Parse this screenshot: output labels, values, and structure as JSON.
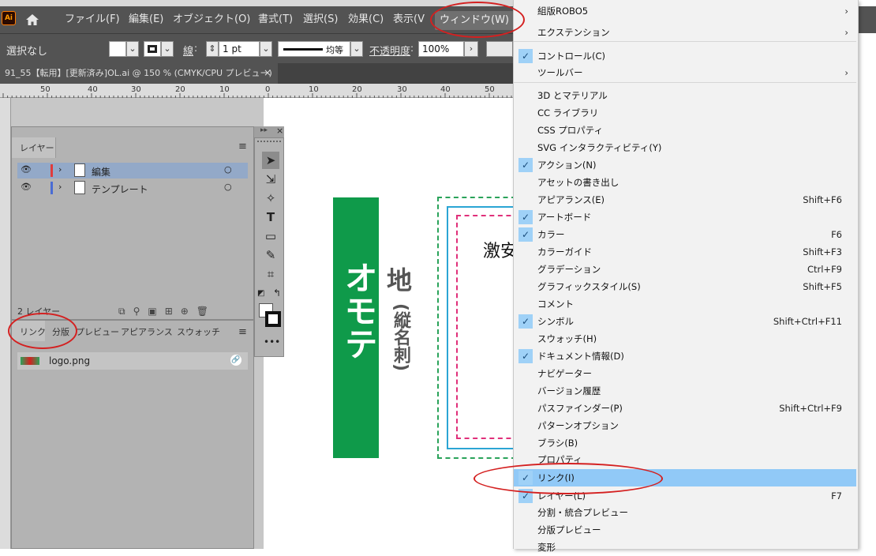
{
  "menubar": {
    "app_icon": "Ai",
    "items": [
      "ファイル(F)",
      "編集(E)",
      "オブジェクト(O)",
      "書式(T)",
      "選択(S)",
      "効果(C)",
      "表示(V",
      "ウィンドウ(W)"
    ]
  },
  "control_bar": {
    "selection": "選択なし",
    "stroke_label": "線",
    "stroke_weight": "1 pt",
    "stroke_style": "均等",
    "opacity_label": "不透明度",
    "opacity_value": "100%"
  },
  "document_tab": {
    "title": "91_55【転用】[更新済み]OL.ai @ 150 % (CMYK/CPU プレビュー)",
    "close": "×"
  },
  "ruler": {
    "ticks": [
      "50",
      "40",
      "30",
      "20",
      "10",
      "0",
      "10",
      "20",
      "30",
      "40",
      "50"
    ]
  },
  "layers_panel": {
    "tab": "レイヤー",
    "layers": [
      {
        "name": "編集",
        "color": "#e03c3c"
      },
      {
        "name": "テンプレート",
        "color": "#4a6cd4"
      }
    ],
    "footer": "2 レイヤー"
  },
  "links_panel": {
    "tabs": [
      "リンク",
      "分版",
      "プレビュー",
      "アピアランス",
      "スウォッチ"
    ],
    "files": [
      {
        "name": "logo.png"
      }
    ]
  },
  "artwork": {
    "vertical_title": "オモテ",
    "side_text_1": "地",
    "side_text_2": "(縦名刺)",
    "card_text": "激安"
  },
  "window_menu": {
    "items": [
      {
        "label": "組版ROBO5",
        "submenu": true,
        "checked": false,
        "shortcut": ""
      },
      {
        "label": "エクステンション",
        "submenu": true,
        "checked": false,
        "shortcut": ""
      },
      {
        "label": "コントロール(C)",
        "submenu": false,
        "checked": true,
        "shortcut": ""
      },
      {
        "label": "ツールバー",
        "submenu": true,
        "checked": false,
        "shortcut": ""
      },
      {
        "label": "3D とマテリアル",
        "submenu": false,
        "checked": false,
        "shortcut": ""
      },
      {
        "label": "CC ライブラリ",
        "submenu": false,
        "checked": false,
        "shortcut": ""
      },
      {
        "label": "CSS プロパティ",
        "submenu": false,
        "checked": false,
        "shortcut": ""
      },
      {
        "label": "SVG インタラクティビティ(Y)",
        "submenu": false,
        "checked": false,
        "shortcut": ""
      },
      {
        "label": "アクション(N)",
        "submenu": false,
        "checked": true,
        "shortcut": ""
      },
      {
        "label": "アセットの書き出し",
        "submenu": false,
        "checked": false,
        "shortcut": ""
      },
      {
        "label": "アピアランス(E)",
        "submenu": false,
        "checked": false,
        "shortcut": "Shift+F6"
      },
      {
        "label": "アートボード",
        "submenu": false,
        "checked": true,
        "shortcut": ""
      },
      {
        "label": "カラー",
        "submenu": false,
        "checked": true,
        "shortcut": "F6"
      },
      {
        "label": "カラーガイド",
        "submenu": false,
        "checked": false,
        "shortcut": "Shift+F3"
      },
      {
        "label": "グラデーション",
        "submenu": false,
        "checked": false,
        "shortcut": "Ctrl+F9"
      },
      {
        "label": "グラフィックスタイル(S)",
        "submenu": false,
        "checked": false,
        "shortcut": "Shift+F5"
      },
      {
        "label": "コメント",
        "submenu": false,
        "checked": false,
        "shortcut": ""
      },
      {
        "label": "シンボル",
        "submenu": false,
        "checked": true,
        "shortcut": "Shift+Ctrl+F11"
      },
      {
        "label": "スウォッチ(H)",
        "submenu": false,
        "checked": false,
        "shortcut": ""
      },
      {
        "label": "ドキュメント情報(D)",
        "submenu": false,
        "checked": true,
        "shortcut": ""
      },
      {
        "label": "ナビゲーター",
        "submenu": false,
        "checked": false,
        "shortcut": ""
      },
      {
        "label": "バージョン履歴",
        "submenu": false,
        "checked": false,
        "shortcut": ""
      },
      {
        "label": "パスファインダー(P)",
        "submenu": false,
        "checked": false,
        "shortcut": "Shift+Ctrl+F9"
      },
      {
        "label": "パターンオプション",
        "submenu": false,
        "checked": false,
        "shortcut": ""
      },
      {
        "label": "ブラシ(B)",
        "submenu": false,
        "checked": false,
        "shortcut": ""
      },
      {
        "label": "プロパティ",
        "submenu": false,
        "checked": false,
        "shortcut": ""
      },
      {
        "label": "リンク(I)",
        "submenu": false,
        "checked": true,
        "shortcut": "",
        "highlighted": true
      },
      {
        "label": "レイヤー(L)",
        "submenu": false,
        "checked": true,
        "shortcut": "F7"
      },
      {
        "label": "分割・統合プレビュー",
        "submenu": false,
        "checked": false,
        "shortcut": ""
      },
      {
        "label": "分版プレビュー",
        "submenu": false,
        "checked": false,
        "shortcut": ""
      },
      {
        "label": "変形",
        "submenu": false,
        "checked": false,
        "shortcut": ""
      }
    ]
  },
  "colors": {
    "accent_green": "#0f9a4a",
    "highlight": "#91c9f7",
    "annotation_red": "#d42020"
  }
}
